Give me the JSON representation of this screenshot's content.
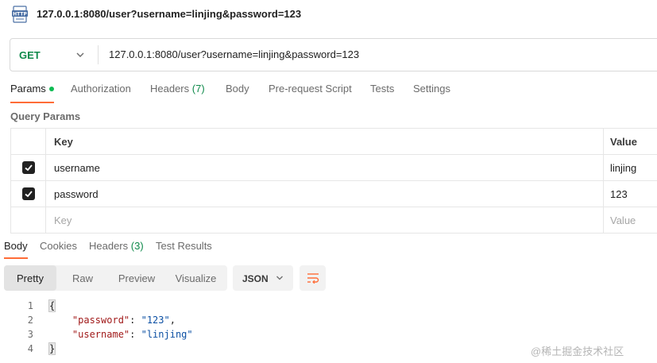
{
  "title": {
    "icon": "http-file-icon",
    "icon_label": "HTTP",
    "text": "127.0.0.1:8080/user?username=linjing&password=123"
  },
  "request": {
    "method": "GET",
    "url": "127.0.0.1:8080/user?username=linjing&password=123"
  },
  "request_tabs": [
    {
      "label": "Params",
      "active": true,
      "has_dot": true
    },
    {
      "label": "Authorization"
    },
    {
      "label": "Headers",
      "count": "(7)"
    },
    {
      "label": "Body"
    },
    {
      "label": "Pre-request Script"
    },
    {
      "label": "Tests"
    },
    {
      "label": "Settings"
    }
  ],
  "query_params": {
    "title": "Query Params",
    "columns": {
      "key": "Key",
      "value": "Value"
    },
    "rows": [
      {
        "checked": true,
        "key": "username",
        "value": "linjing"
      },
      {
        "checked": true,
        "key": "password",
        "value": "123"
      }
    ],
    "placeholder": {
      "key": "Key",
      "value": "Value"
    }
  },
  "response_tabs": [
    {
      "label": "Body",
      "active": true
    },
    {
      "label": "Cookies"
    },
    {
      "label": "Headers",
      "count": "(3)"
    },
    {
      "label": "Test Results"
    }
  ],
  "view_modes": [
    {
      "label": "Pretty",
      "active": true
    },
    {
      "label": "Raw"
    },
    {
      "label": "Preview"
    },
    {
      "label": "Visualize"
    }
  ],
  "format": {
    "label": "JSON",
    "icon": "chevron-down-icon"
  },
  "wrap_icon": "wrap-lines-icon",
  "code_lines": [
    {
      "num": "1",
      "text": "{"
    },
    {
      "num": "2",
      "key": "\"password\"",
      "sep": ": ",
      "val": "\"123\"",
      "tail": ","
    },
    {
      "num": "3",
      "key": "\"username\"",
      "sep": ": ",
      "val": "\"linjing\"",
      "tail": ""
    },
    {
      "num": "4",
      "text": "}"
    }
  ],
  "watermark": "@稀土掘金技术社区",
  "colors": {
    "accent": "#ff6c37",
    "method_green": "#0f8a4b",
    "active_dot": "#0cbb52",
    "json_key": "#a11a1a",
    "json_string": "#0b4fa3"
  }
}
